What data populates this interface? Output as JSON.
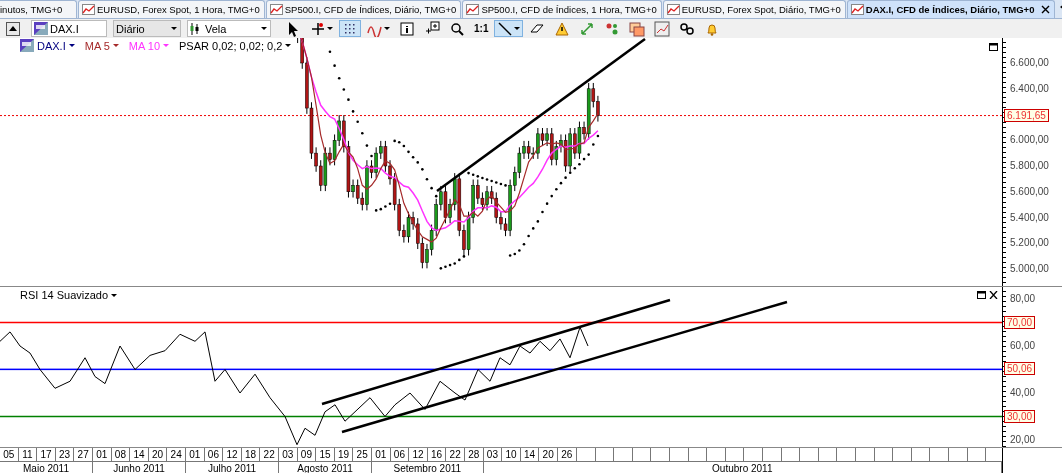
{
  "tabs": [
    {
      "label": "inutos, TMG+0",
      "selected": false,
      "icon": false
    },
    {
      "label": "EURUSD, Forex Spot, 1 Hora, TMG+0",
      "selected": false,
      "icon": true
    },
    {
      "label": "SP500.I, CFD de Índices, Diário, TMG+0",
      "selected": false,
      "icon": true
    },
    {
      "label": "SP500.I, CFD de Índices, 1 Hora, TMG+0",
      "selected": false,
      "icon": true
    },
    {
      "label": "EURUSD, Forex Spot, Diário, TMG+0",
      "selected": false,
      "icon": true
    },
    {
      "label": "DAX.I, CFD de Índices, Diário, TMG+0",
      "selected": true,
      "icon": true
    }
  ],
  "toolbar": {
    "symbol": "DAX.I",
    "period": "Diário",
    "chart_type": "Vela",
    "tools": [
      {
        "kind": "pointer",
        "selected": false,
        "has_menu": false
      },
      {
        "kind": "crosshair",
        "selected": false,
        "has_menu": true
      },
      {
        "kind": "grid",
        "selected": true,
        "has_menu": false
      },
      {
        "kind": "indicator",
        "selected": false,
        "has_menu": true
      },
      {
        "kind": "info",
        "selected": false,
        "has_menu": false
      },
      {
        "kind": "add-panel",
        "selected": false,
        "has_menu": false
      },
      {
        "kind": "zoom",
        "selected": false,
        "has_menu": false
      },
      {
        "kind": "text",
        "label": "1:1",
        "selected": false,
        "has_menu": false
      },
      {
        "kind": "line",
        "selected": true,
        "has_menu": true
      },
      {
        "kind": "eraser",
        "selected": false,
        "has_menu": false
      },
      {
        "kind": "warning",
        "selected": false,
        "has_menu": false
      },
      {
        "kind": "arrows",
        "selected": false,
        "has_menu": false
      },
      {
        "kind": "dots",
        "selected": false,
        "has_menu": false
      },
      {
        "kind": "windows",
        "selected": false,
        "has_menu": false
      },
      {
        "kind": "chart-window",
        "selected": false,
        "has_menu": false
      },
      {
        "kind": "link",
        "selected": false,
        "has_menu": false
      },
      {
        "kind": "bell",
        "selected": false,
        "has_menu": false
      }
    ]
  },
  "price_panel": {
    "legend": [
      {
        "label": "DAX.I",
        "color": "#000080",
        "kind": "symbol"
      },
      {
        "label": "MA 5",
        "color": "#a52a2a",
        "kind": "ma"
      },
      {
        "label": "MA 10",
        "color": "#ff33ff",
        "kind": "ma"
      },
      {
        "label": "PSAR 0,02; 0,02; 0,2",
        "color": "#000000",
        "kind": "psar"
      }
    ],
    "y_labels": [
      "6.600,00",
      "6.400,00",
      "6.000,00",
      "5.800,00",
      "5.600,00",
      "5.400,00",
      "5.200,00",
      "5.000,00"
    ],
    "last_price": "6.191,65"
  },
  "rsi_panel": {
    "legend": "RSI 14 Suavizado",
    "y_labels": [
      "80,00",
      "60,00",
      "40,00",
      "20,00"
    ],
    "levels": [
      {
        "label": "70,00",
        "color": "#ff0000"
      },
      {
        "label": "50,06",
        "color": "#0000ff"
      },
      {
        "label": "30,00",
        "color": "#008000"
      }
    ]
  },
  "time_axis": {
    "months": [
      {
        "label": "Maio 2011",
        "days": [
          "05",
          "11",
          "17",
          "23",
          "27"
        ]
      },
      {
        "label": "Junho 2011",
        "days": [
          "01",
          "08",
          "14",
          "20",
          "24"
        ]
      },
      {
        "label": "Julho 2011",
        "days": [
          "01",
          "06",
          "12",
          "18",
          "22"
        ]
      },
      {
        "label": "Agosto 2011",
        "days": [
          "03",
          "09",
          "15",
          "19",
          "25"
        ]
      },
      {
        "label": "Setembro 2011",
        "days": [
          "01",
          "06",
          "12",
          "16",
          "22",
          "28"
        ]
      },
      {
        "label": "Outubro 2011",
        "days": [
          "03",
          "10",
          "14",
          "20",
          "26"
        ]
      }
    ]
  }
}
